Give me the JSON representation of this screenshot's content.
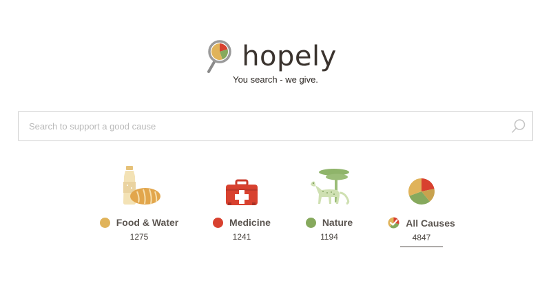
{
  "brand": {
    "name": "hopely",
    "tagline": "You search - we give."
  },
  "search": {
    "placeholder": "Search to support a good cause",
    "value": ""
  },
  "causes": [
    {
      "label": "Food & Water",
      "count": "1275",
      "color": "#e0b35a",
      "icon": "bread-and-bottle-icon"
    },
    {
      "label": "Medicine",
      "count": "1241",
      "color": "#d8412f",
      "icon": "first-aid-kit-icon"
    },
    {
      "label": "Nature",
      "count": "1194",
      "color": "#86a95d",
      "icon": "cheetah-and-tree-icon"
    },
    {
      "label": "All Causes",
      "count": "4847",
      "color": "#e0b35a",
      "icon": "pie-chart-icon",
      "selected": true
    }
  ],
  "colors": {
    "food": "#e0b35a",
    "medicine": "#d8412f",
    "nature": "#86a95d",
    "text": "#3a332e"
  }
}
